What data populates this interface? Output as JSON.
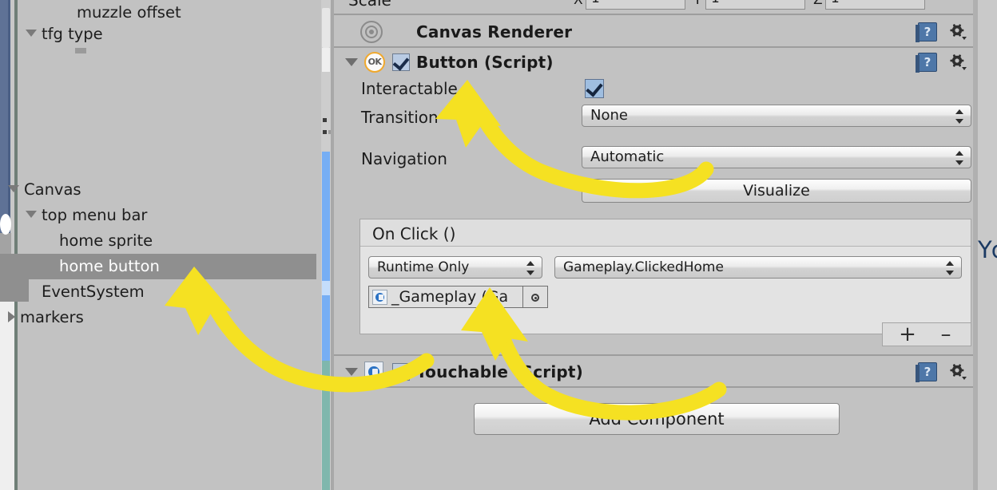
{
  "app": "Unity Editor",
  "hierarchy": {
    "panel_name": "Hierarchy",
    "items": [
      {
        "label": "muzzle offset",
        "indent": 3,
        "arrow": "none",
        "selected": false
      },
      {
        "label": "tfg type",
        "indent": 1,
        "arrow": "down",
        "selected": false
      },
      {
        "label": "Canvas",
        "indent": 0,
        "arrow": "down",
        "selected": false
      },
      {
        "label": "top menu bar",
        "indent": 1,
        "arrow": "down",
        "selected": false
      },
      {
        "label": "home sprite",
        "indent": 2,
        "arrow": "none",
        "selected": false
      },
      {
        "label": "home button",
        "indent": 2,
        "arrow": "none",
        "selected": true
      },
      {
        "label": "EventSystem",
        "indent": 1,
        "arrow": "none",
        "selected": false
      },
      {
        "label": "markers",
        "indent": 0,
        "arrow": "right",
        "selected": false
      }
    ],
    "selection_color": "#8f8f8f",
    "selection_text_color": "#ffffff"
  },
  "inspector": {
    "scale_row": {
      "label": "Scale",
      "x_label": "X",
      "y_label": "Y",
      "z_label": "Z",
      "x_value": "1",
      "y_value": "1",
      "z_value": "1"
    },
    "components": [
      {
        "title": "Canvas Renderer",
        "icon": "canvas-renderer-icon",
        "help": "?",
        "has_foldout": false,
        "has_enable_checkbox": false
      },
      {
        "title": "Button (Script)",
        "icon": "ok-badge-icon",
        "help": "?",
        "has_foldout": true,
        "has_enable_checkbox": true,
        "enabled": true
      },
      {
        "title": "Touchable (Script)",
        "icon": "script-file-icon",
        "help": "?",
        "has_foldout": true,
        "has_enable_checkbox": true,
        "enabled": false
      }
    ],
    "button_script": {
      "interactable": {
        "label": "Interactable",
        "checked": true
      },
      "transition": {
        "label": "Transition",
        "value": "None"
      },
      "navigation": {
        "label": "Navigation",
        "value": "Automatic"
      },
      "visualize_button": "Visualize",
      "on_click": {
        "header": "On Click ()",
        "entries": [
          {
            "mode": "Runtime Only",
            "function": "Gameplay.ClickedHome",
            "object": "_Gameplay (Ga",
            "object_icon": "script-object-icon",
            "picker_icon": "target-picker-icon"
          }
        ],
        "add_label": "+",
        "remove_label": "–"
      }
    },
    "add_component_button": "Add Component"
  },
  "annotations": {
    "arrow_color": "#f5e122",
    "arrows": [
      {
        "name": "arrow-to-interactable",
        "points_at": "Interactable"
      },
      {
        "name": "arrow-to-home-button",
        "points_at": "home button"
      },
      {
        "name": "arrow-to-gameplay-object",
        "points_at": "_Gameplay (Ga"
      }
    ]
  },
  "offscreen": {
    "right_text": "Yc"
  },
  "colors": {
    "panel_bg": "#c2c2c2",
    "selection": "#8f8f8f",
    "accent_scrollbar": "#76aef4",
    "highlight": "#f5e122"
  }
}
